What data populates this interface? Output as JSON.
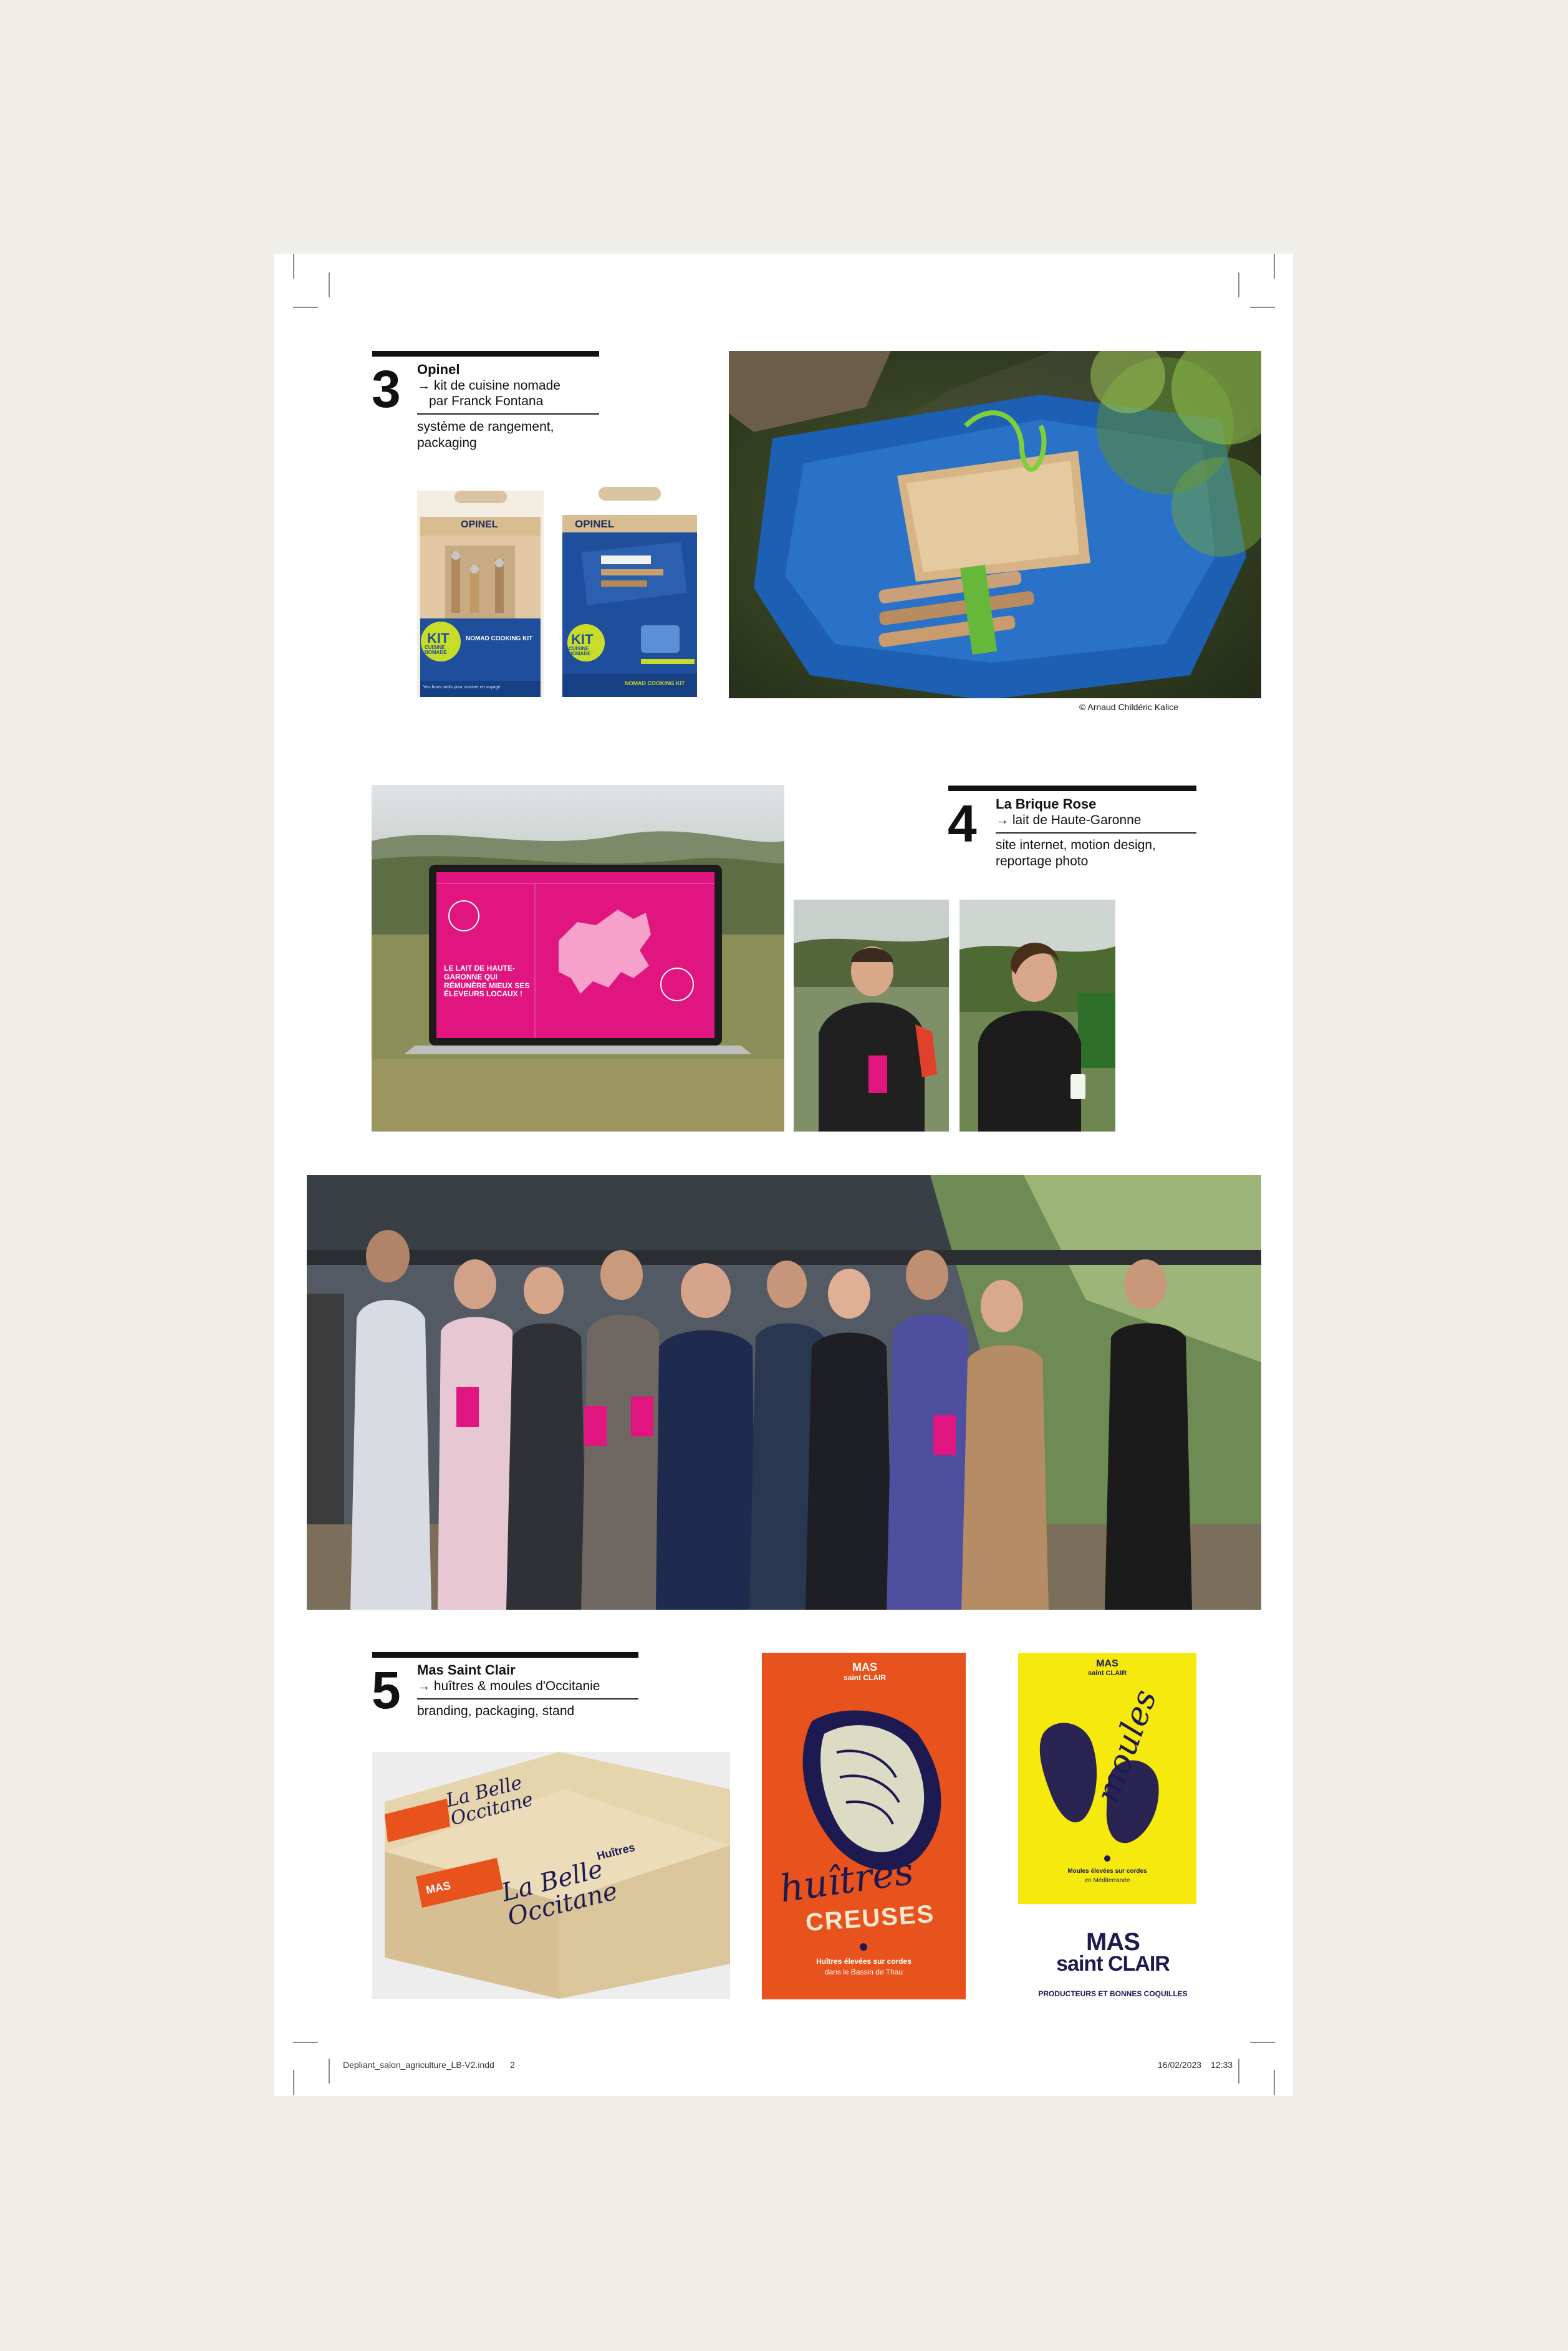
{
  "projects": [
    {
      "number": "3",
      "client": "Opinel",
      "subject": "→ kit de cuisine nomade",
      "author": "par Franck Fontana",
      "services": "système de rangement, packaging",
      "photo_credit": "© Arnaud Childéric Kalice",
      "packaging": {
        "brand": "OPINEL",
        "kit_word": "KIT",
        "kit_sub": "CUISINE NOMADE",
        "product_name": "NOMAD COOKING KIT",
        "tagline": "Vos bons outils pour cuisiner en voyage"
      }
    },
    {
      "number": "4",
      "client": "La Brique Rose",
      "subject": "→ lait de Haute-Garonne",
      "services": "site internet, motion design, reportage photo",
      "screen_headline": "LE LAIT DE HAUTE-GARONNE QUI RÉMUNÈRE MIEUX SES ÉLEVEURS LOCAUX !"
    },
    {
      "number": "5",
      "client": "Mas Saint Clair",
      "subject": "→ huîtres & moules d'Occitanie",
      "services": "branding, packaging, stand",
      "brand_top": "MAS",
      "brand_bottom": "saint CLAIR",
      "brand_tagline": "PRODUCTEURS ET BONNES COQUILLES",
      "box_text": "La Belle Occitane",
      "box_label": "Huîtres",
      "poster_oyster": {
        "word1": "huîtres",
        "word2": "CREUSES",
        "line1": "Huîtres élevées sur cordes",
        "line2": "dans le Bassin de Thau"
      },
      "poster_mussel": {
        "word1": "moules",
        "line1": "Moules élevées sur cordes",
        "line2": "en Méditerranée"
      }
    }
  ],
  "footer": {
    "filename": "Depliant_salon_agriculture_LB-V2.indd",
    "page": "2",
    "date": "16/02/2023",
    "time": "12:33"
  },
  "colors": {
    "pink": "#e0157f",
    "orange": "#e8531d",
    "yellow": "#f6e90d",
    "navy": "#1d1a52",
    "opinel_blue": "#1f4e9c"
  }
}
